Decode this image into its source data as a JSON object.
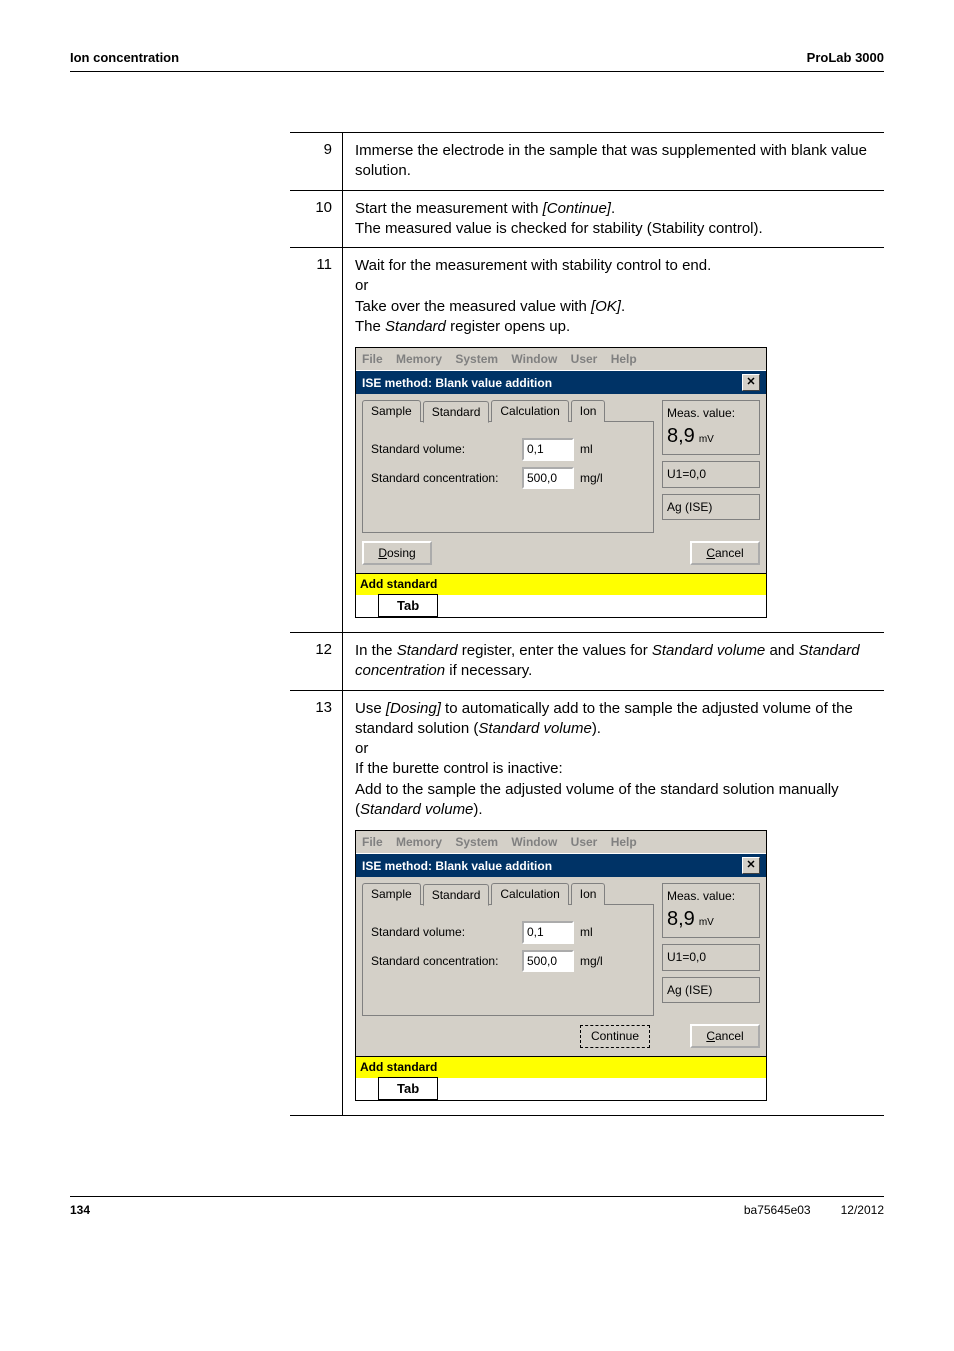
{
  "header": {
    "left": "Ion concentration",
    "right": "ProLab 3000"
  },
  "steps": {
    "s9": {
      "n": "9",
      "text": "Immerse the electrode in the sample that was supplemented with blank value solution."
    },
    "s10": {
      "n": "10",
      "text_a": "Start the measurement with ",
      "italic_a": "[Continue]",
      "text_b": ".\nThe measured value is checked for stability (Stability control)."
    },
    "s11": {
      "n": "11",
      "text_a": "Wait for the measurement with stability control to end.\nor\nTake over the measured value with ",
      "italic_a": "[OK]",
      "text_b": ".\nThe ",
      "italic_b": "Standard",
      "text_c": " register opens up."
    },
    "s12": {
      "n": "12",
      "text_a": "In the ",
      "italic_a": "Standard",
      "text_b": " register, enter the values for ",
      "italic_b": "Standard volume",
      "text_c": " and ",
      "italic_c": "Standard concentration",
      "text_d": " if necessary."
    },
    "s13": {
      "n": "13",
      "text_a": "Use ",
      "italic_a": "[Dosing]",
      "text_b": " to automatically add to the sample the adjusted volume of the standard solution (",
      "italic_b": "Standard volume",
      "text_c": ").\nor\nIf the burette control is inactive:\nAdd to the sample the adjusted volume of the standard solution manually (",
      "italic_c": "Standard volume",
      "text_d": ")."
    }
  },
  "ui": {
    "menus": {
      "file": "File",
      "memory": "Memory",
      "system": "System",
      "window": "Window",
      "user": "User",
      "help": "Help"
    },
    "title": "ISE method:  Blank value addition",
    "tabs": {
      "sample": "Sample",
      "standard": "Standard",
      "calculation": "Calculation",
      "ion": "Ion"
    },
    "fields": {
      "std_volume_label": "Standard volume:",
      "std_volume_value": "0,1",
      "std_volume_unit": "ml",
      "std_conc_label": "Standard concentration:",
      "std_conc_value": "500,0",
      "std_conc_unit": "mg/l"
    },
    "meas": {
      "label": "Meas. value:",
      "value": "8,9",
      "unit": "mV"
    },
    "u1": "U1=0,0",
    "ag": "Ag (ISE)",
    "buttons": {
      "dosing_u": "D",
      "dosing_rest": "osing",
      "continue": "Continue",
      "cancel_u": "C",
      "cancel_rest": "ancel"
    },
    "status": "Add standard",
    "tab_caption": "Tab"
  },
  "footer": {
    "page": "134",
    "doc": "ba75645e03",
    "date": "12/2012"
  }
}
